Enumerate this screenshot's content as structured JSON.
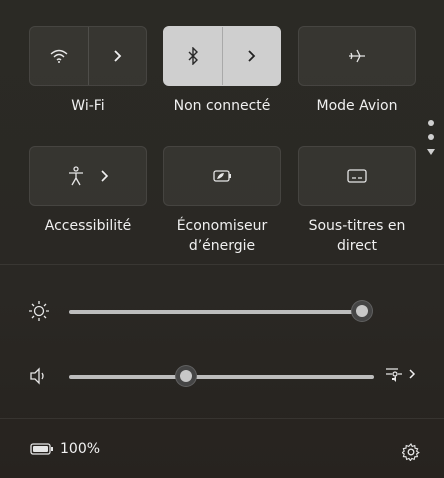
{
  "tiles": [
    {
      "label": "Wi-Fi",
      "icon": "wifi-icon",
      "has_arrow": true,
      "active": false
    },
    {
      "label": "Non connecté",
      "icon": "bluetooth-icon",
      "has_arrow": true,
      "active": true
    },
    {
      "label": "Mode Avion",
      "icon": "airplane-icon",
      "has_arrow": false,
      "active": false
    },
    {
      "label": "Accessibilité",
      "icon": "accessibility-icon",
      "has_arrow": true,
      "active": false
    },
    {
      "label": "Économiseur d’énergie",
      "icon": "battery-saver-icon",
      "has_arrow": false,
      "active": false
    },
    {
      "label": "Sous-titres en direct",
      "icon": "captions-icon",
      "has_arrow": false,
      "active": false
    }
  ],
  "brightness": {
    "level": 0.98
  },
  "volume": {
    "level": 0.38
  },
  "footer": {
    "battery_text": "100%"
  },
  "colors": {
    "accent_active_tile": "#cfcfcf",
    "track": "#bdbdbd"
  }
}
